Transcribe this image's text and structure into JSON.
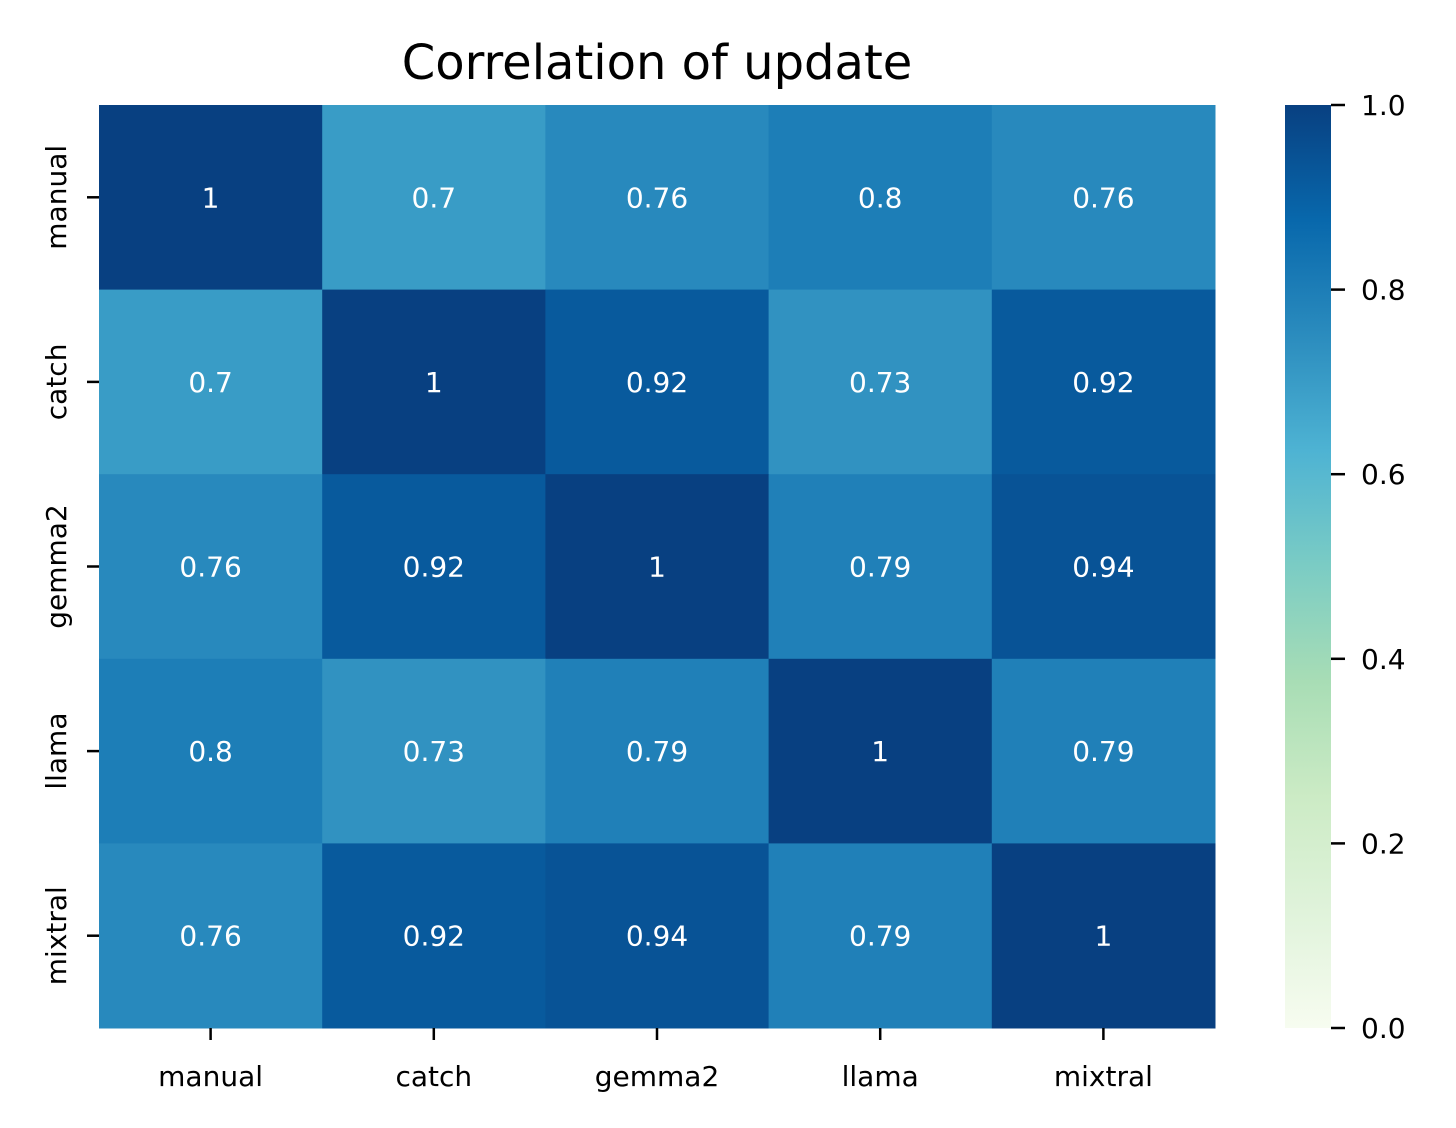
{
  "chart_data": {
    "type": "heatmap",
    "title": "Correlation of update",
    "xlabel": "",
    "ylabel": "",
    "x_categories": [
      "manual",
      "catch",
      "gemma2",
      "llama",
      "mixtral"
    ],
    "y_categories": [
      "manual",
      "catch",
      "gemma2",
      "llama",
      "mixtral"
    ],
    "values": [
      [
        1,
        0.7,
        0.76,
        0.8,
        0.76
      ],
      [
        0.7,
        1,
        0.92,
        0.73,
        0.92
      ],
      [
        0.76,
        0.92,
        1,
        0.79,
        0.94
      ],
      [
        0.8,
        0.73,
        0.79,
        1,
        0.79
      ],
      [
        0.76,
        0.92,
        0.94,
        0.79,
        1
      ]
    ],
    "annotations": true,
    "colormap": "GnBu",
    "colorbar": {
      "vmin": 0.0,
      "vmax": 1.0,
      "ticks": [
        0.0,
        0.2,
        0.4,
        0.6,
        0.8,
        1.0
      ],
      "tick_labels": [
        "0.0",
        "0.2",
        "0.4",
        "0.6",
        "0.8",
        "1.0"
      ],
      "position": "right"
    },
    "colormap_stops": [
      "#f7fcf0",
      "#e0f3db",
      "#ccebc5",
      "#a8ddb5",
      "#7bccc4",
      "#4eb3d3",
      "#2b8cbe",
      "#0868ac",
      "#084081"
    ],
    "annotation_color": "#ffffff",
    "grid": false
  }
}
